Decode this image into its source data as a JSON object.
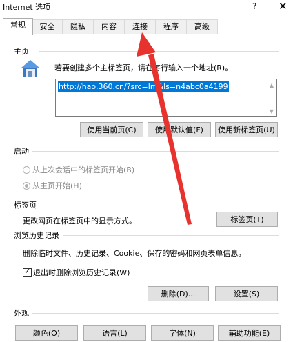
{
  "window": {
    "title": "Internet 选项",
    "help": "?",
    "close": "✕"
  },
  "tabs": [
    {
      "label": "常规"
    },
    {
      "label": "安全"
    },
    {
      "label": "隐私"
    },
    {
      "label": "内容"
    },
    {
      "label": "连接"
    },
    {
      "label": "程序"
    },
    {
      "label": "高级"
    }
  ],
  "home": {
    "section": "主页",
    "description": "若要创建多个主标签页，请在每行输入一个地址(R)。",
    "url": "http://hao.360.cn/?src=lm&ls=n4abc0a4199",
    "btn_current": "使用当前页(C)",
    "btn_default": "使用默认值(F)",
    "btn_newtab": "使用新标签页(U)"
  },
  "startup": {
    "section": "启动",
    "option_last": "从上次会话中的标签页开始(B)",
    "option_home": "从主页开始(H)"
  },
  "tabs_section": {
    "section": "标签页",
    "description": "更改网页在标签页中的显示方式。",
    "btn": "标签页(T)"
  },
  "history": {
    "section": "浏览历史记录",
    "description": "删除临时文件、历史记录、Cookie、保存的密码和网页表单信息。",
    "checkbox": "退出时删除浏览历史记录(W)",
    "checked": true,
    "btn_delete": "删除(D)...",
    "btn_settings": "设置(S)"
  },
  "appearance": {
    "section": "外观",
    "btn_colors": "颜色(O)",
    "btn_language": "语言(L)",
    "btn_fonts": "字体(N)",
    "btn_accessibility": "辅助功能(E)"
  },
  "annotation": {
    "color": "#e8322d"
  }
}
